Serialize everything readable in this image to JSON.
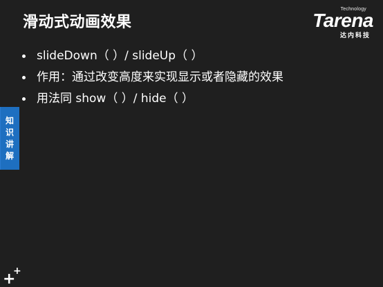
{
  "slide": {
    "title": "滑动式动画效果",
    "bullets": [
      {
        "text": "slideDown（ ）/ slideUp（ ）"
      },
      {
        "text": "作用：通过改变高度来实现显示或者隐藏的效果"
      },
      {
        "text": "用法同 show（ ）/ hide（ ）"
      }
    ]
  },
  "logo": {
    "tagline": "Technology",
    "brand": "Tarena",
    "chinese": "达内科技"
  },
  "side_tab": {
    "chars": [
      "知",
      "识",
      "讲",
      "解"
    ]
  },
  "decor": {
    "plus_big": "+",
    "plus_small": "+"
  },
  "colors": {
    "background": "#1f1f1f",
    "text": "#ffffff",
    "tab_blue": "#1e6fc0"
  }
}
